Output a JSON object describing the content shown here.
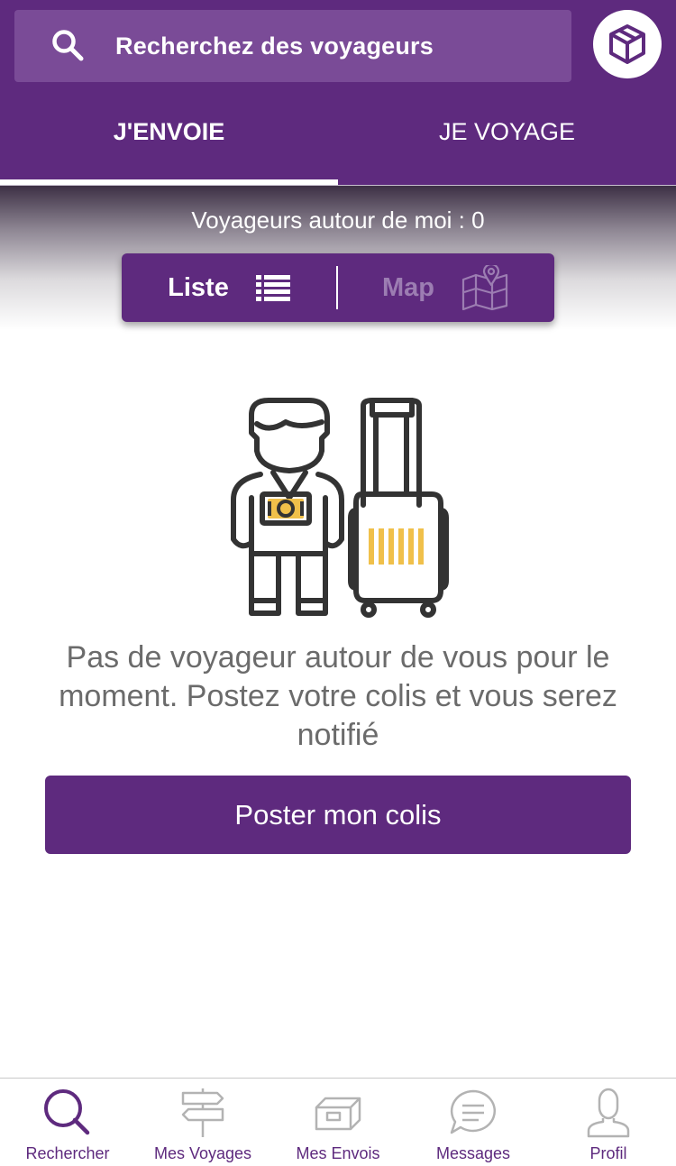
{
  "search": {
    "placeholder": "Recherchez des voyageurs",
    "icon": "search-icon"
  },
  "header": {
    "box_icon": "package-icon"
  },
  "tabs": [
    {
      "label": "J'ENVOIE",
      "active": true
    },
    {
      "label": "JE VOYAGE",
      "active": false
    }
  ],
  "travelers_count_text": "Voyageurs autour de moi : 0",
  "view_toggle": {
    "list_label": "Liste",
    "list_icon": "list-icon",
    "map_label": "Map",
    "map_icon": "map-pin-icon",
    "selected": "Liste"
  },
  "empty_state": {
    "illustration": "traveler-with-suitcase",
    "message": "Pas de voyageur autour de vous pour le moment. Postez votre colis et vous serez notifié"
  },
  "primary_action": {
    "label": "Poster mon colis"
  },
  "bottom_nav": [
    {
      "label": "Rechercher",
      "icon": "search-icon",
      "active": true
    },
    {
      "label": "Mes Voyages",
      "icon": "signpost-icon",
      "active": false
    },
    {
      "label": "Mes Envois",
      "icon": "box-icon",
      "active": false
    },
    {
      "label": "Messages",
      "icon": "chat-bubble-icon",
      "active": false
    },
    {
      "label": "Profil",
      "icon": "user-icon",
      "active": false
    }
  ],
  "colors": {
    "brand": "#5e2a7e",
    "accent": "#f0c04a",
    "inactive_icon": "#b3b3b3",
    "text_muted": "#6b6b6b"
  }
}
